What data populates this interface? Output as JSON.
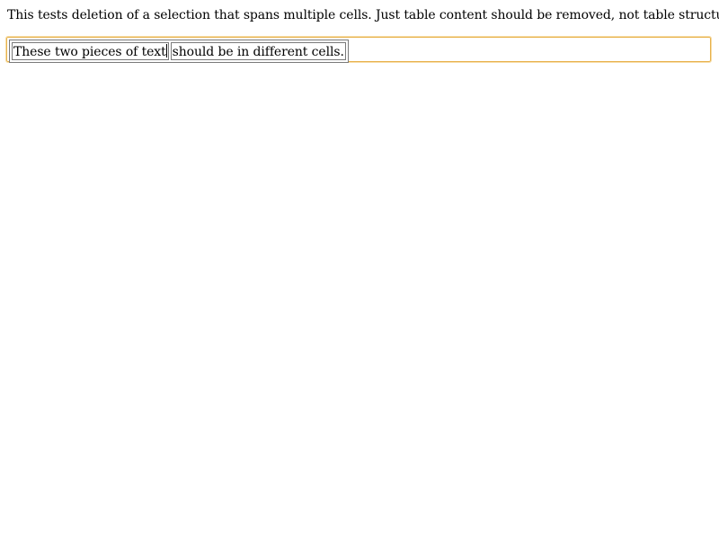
{
  "description": {
    "text": "This tests deletion of a selection that spans multiple cells. Just table content should be removed, not table structure."
  },
  "editor": {
    "border_color": "#e8b24c",
    "table": {
      "rows": [
        {
          "cells": [
            "These two pieces of text",
            "should be in different cells."
          ]
        }
      ]
    }
  }
}
